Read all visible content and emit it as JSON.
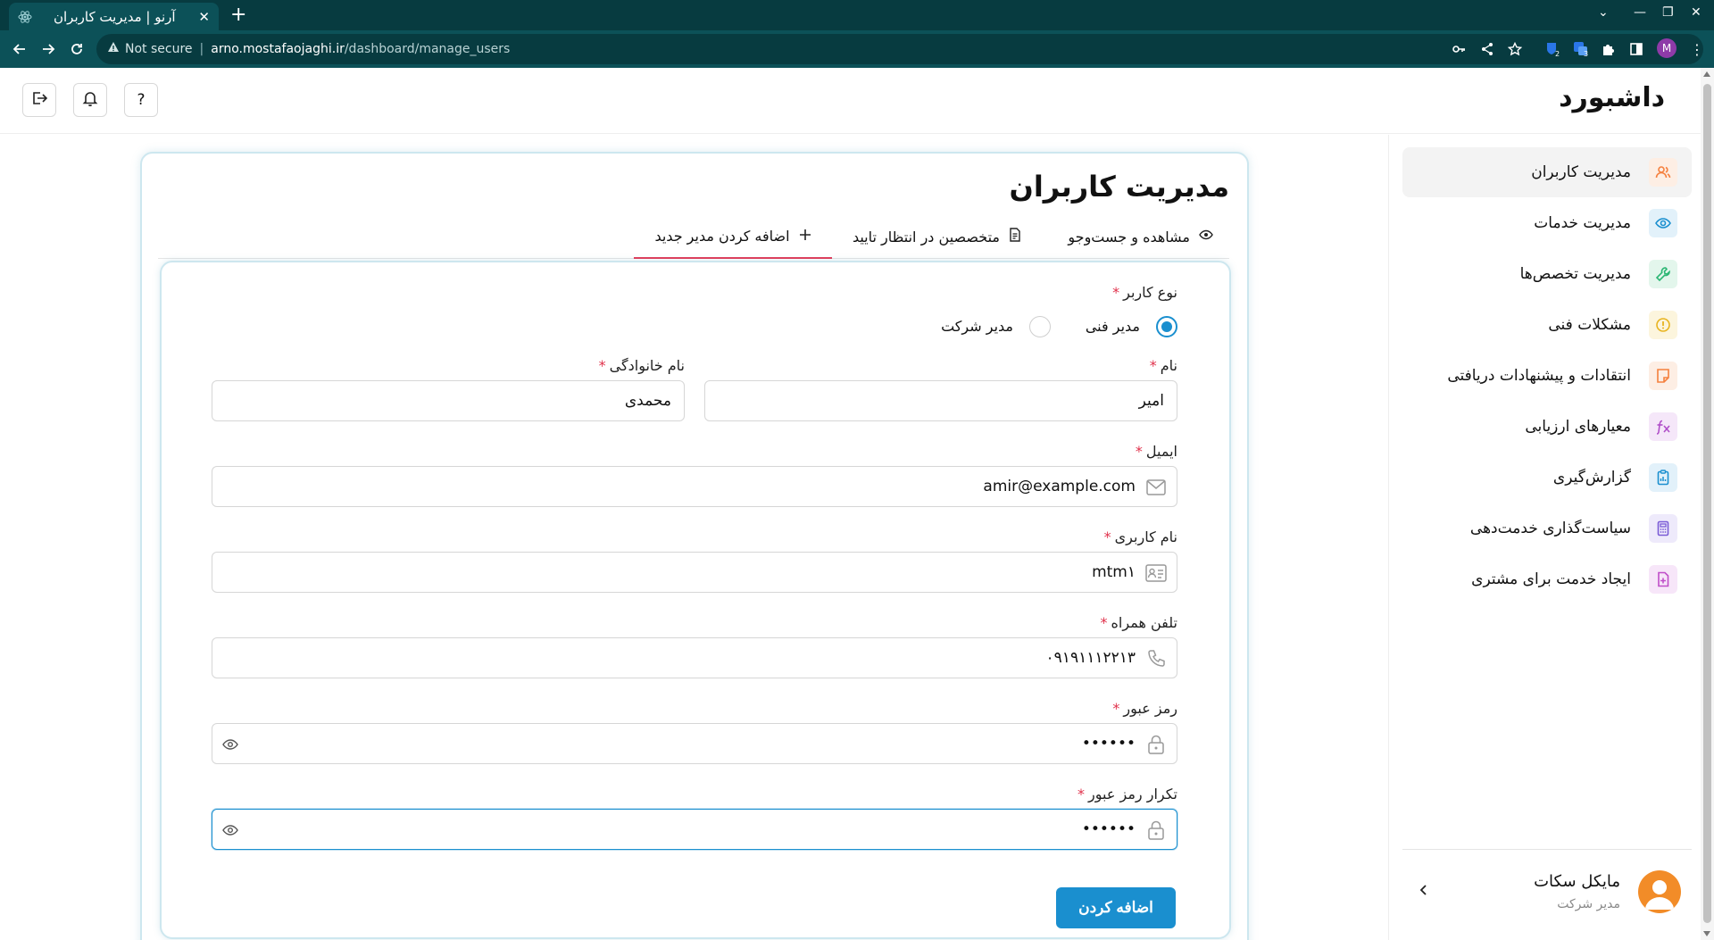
{
  "browser": {
    "tab_title": "آرنو | مدیریت کاربران",
    "new_tab": "+",
    "security_label": "Not secure",
    "url_host": "arno.mostafaojaghi.ir",
    "url_path": "/dashboard/manage_users",
    "profile_initial": "M",
    "ext_badge_1": "2",
    "ext_badge_2": "3"
  },
  "header": {
    "title": "داشبورد",
    "help_label": "?"
  },
  "sidebar": {
    "items": [
      {
        "label": "مدیریت کاربران",
        "icon": "users-icon",
        "color": "#f5803e",
        "bg": "#fdeee4"
      },
      {
        "label": "مدیریت خدمات",
        "icon": "eye-icon",
        "color": "#1a8fcf",
        "bg": "#e2f1fa"
      },
      {
        "label": "مدیریت تخصص‌ها",
        "icon": "wrench-icon",
        "color": "#2bb673",
        "bg": "#e3f6ec"
      },
      {
        "label": "مشکلات فنی",
        "icon": "alert-icon",
        "color": "#e8b420",
        "bg": "#fcf5dd"
      },
      {
        "label": "انتقادات و پیشنهادات دریافتی",
        "icon": "note-icon",
        "color": "#f5803e",
        "bg": "#fdeee4"
      },
      {
        "label": "معیارهای ارزیابی",
        "icon": "function-icon",
        "color": "#b04fc9",
        "bg": "#f5e7f9"
      },
      {
        "label": "گزارش‌گیری",
        "icon": "clipboard-icon",
        "color": "#1a8fcf",
        "bg": "#e2f1fa"
      },
      {
        "label": "سیاست‌گذاری خدمت‌دهی",
        "icon": "calculator-icon",
        "color": "#7a5bd6",
        "bg": "#eeeafb"
      },
      {
        "label": "ایجاد خدمت برای مشتری",
        "icon": "file-plus-icon",
        "color": "#c04fc9",
        "bg": "#f7e6f9"
      }
    ],
    "user": {
      "name": "مایکل سکات",
      "role": "مدیر شرکت"
    }
  },
  "page": {
    "title": "مدیریت کاربران",
    "tabs": [
      {
        "label": "مشاهده و جست‌وجو",
        "icon": "eye-icon"
      },
      {
        "label": "متخصصین در انتظار تایید",
        "icon": "document-icon"
      },
      {
        "label": "اضافه کردن مدیر جدید",
        "icon": "plus-icon"
      }
    ]
  },
  "form": {
    "user_type_label": "نوع کاربر",
    "required_mark": "*",
    "radio_options": [
      {
        "label": "مدیر فنی",
        "checked": true
      },
      {
        "label": "مدیر شرکت",
        "checked": false
      }
    ],
    "first_name_label": "نام",
    "first_name_value": "امیر",
    "last_name_label": "نام خانوادگی",
    "last_name_value": "محمدی",
    "email_label": "ایمیل",
    "email_value": "amir@example.com",
    "username_label": "نام کاربری",
    "username_value": "mtm۱",
    "phone_label": "تلفن همراه",
    "phone_value": "۰۹۱۹۱۱۱۲۲۱۳",
    "password_label": "رمز عبور",
    "password_value": "••••••",
    "confirm_label": "تکرار رمز عبور",
    "confirm_value": "••••••",
    "submit_label": "اضافه کردن"
  },
  "colors": {
    "accent": "#1a8fcf",
    "required": "#e0314b",
    "active_tab": "#e23a57",
    "chrome": "#0c5158"
  }
}
